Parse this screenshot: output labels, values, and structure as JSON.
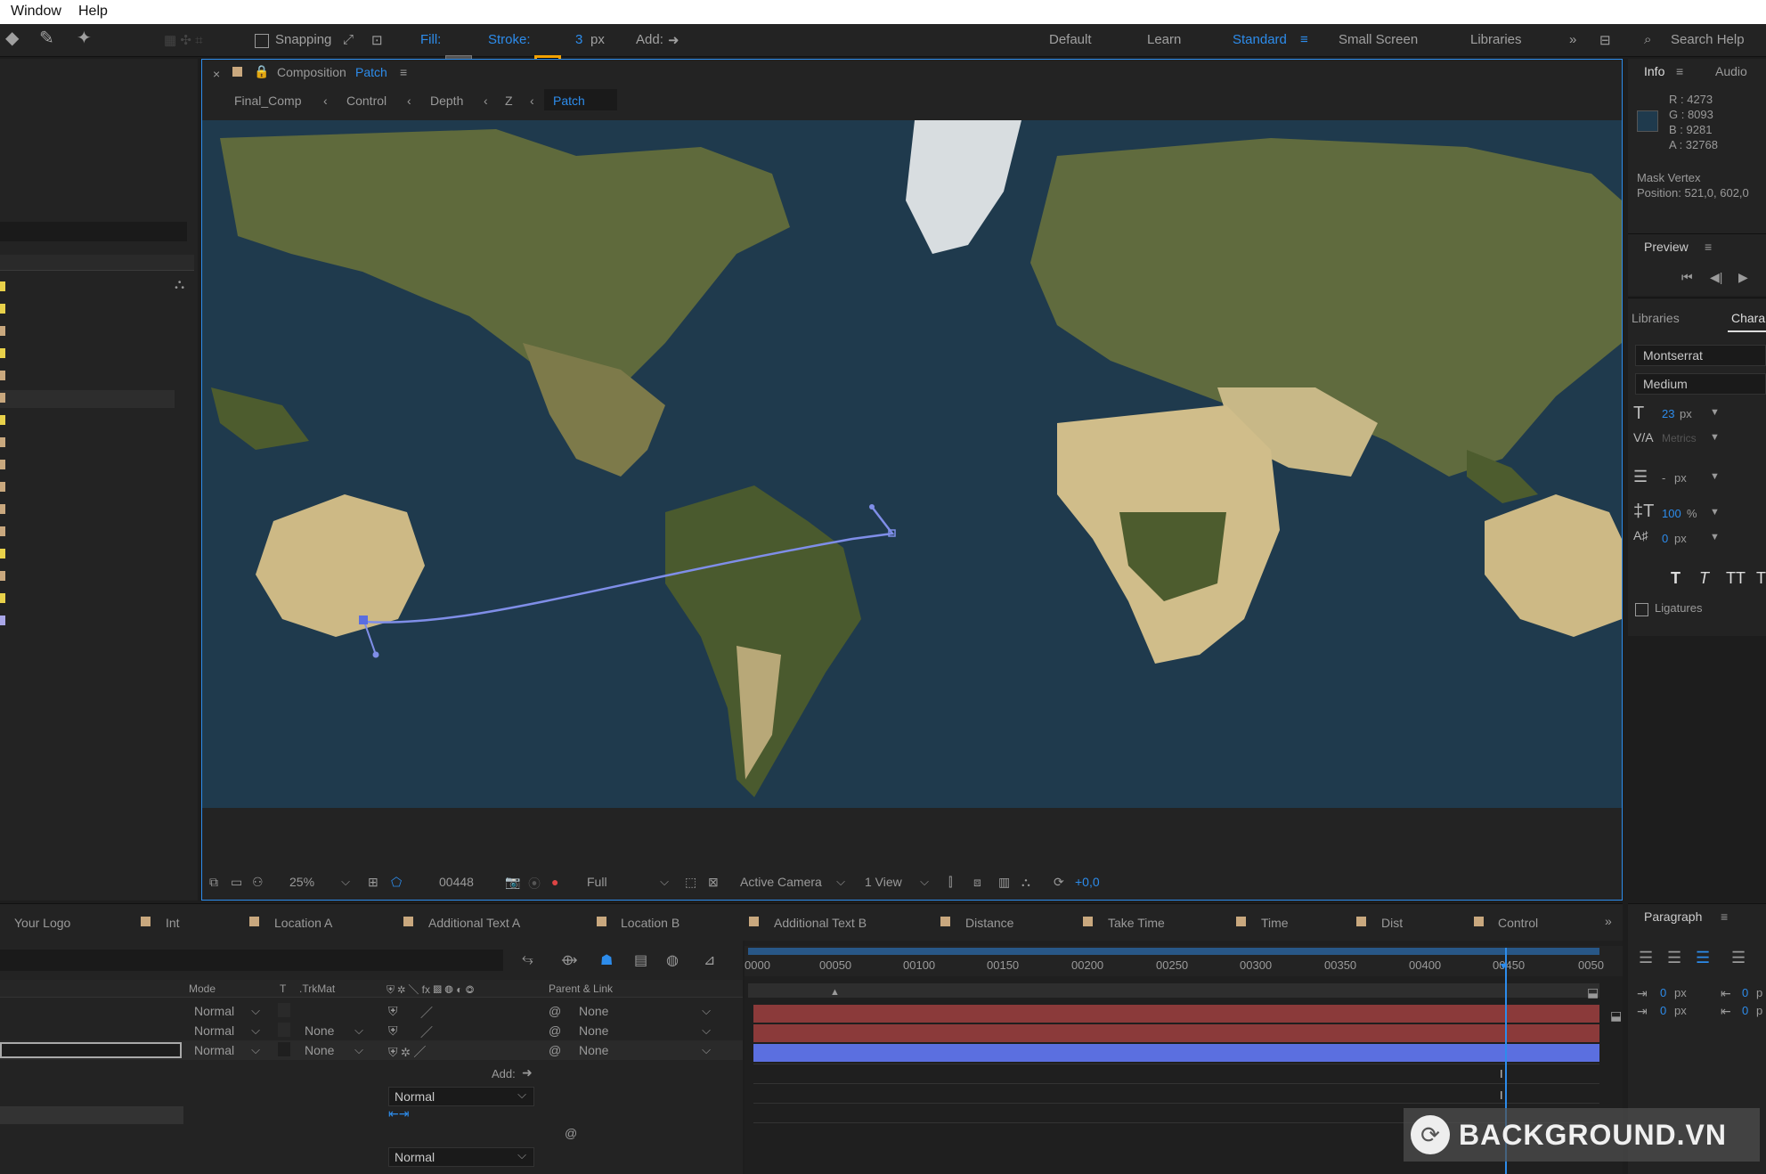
{
  "menu": {
    "items": [
      "Window",
      "Help"
    ]
  },
  "toolbar": {
    "snapping": "Snapping",
    "fill": "Fill:",
    "stroke": "Stroke:",
    "stroke_width": "3",
    "stroke_unit": "px",
    "add": "Add:",
    "workspaces": [
      "Default",
      "Learn",
      "Standard",
      "Small Screen",
      "Libraries"
    ],
    "active_workspace": "Standard",
    "search_help": "Search Help"
  },
  "composition": {
    "tab_prefix": "Composition",
    "tab_name": "Patch",
    "breadcrumbs": [
      "Final_Comp",
      "Control",
      "Depth",
      "Z",
      "Patch"
    ],
    "zoom": "25%",
    "timecode": "00448",
    "resolution": "Full",
    "camera": "Active Camera",
    "views": "1 View",
    "exposure": "+0,0"
  },
  "info_panel": {
    "tabs": [
      "Info",
      "Audio"
    ],
    "r": "R : 4273",
    "g": "G : 8093",
    "b": "B : 9281",
    "a": "A : 32768",
    "mask_title": "Mask Vertex",
    "mask_position": "Position: 521,0, 602,0"
  },
  "preview_panel": {
    "title": "Preview"
  },
  "character_panel": {
    "tabs": [
      "Libraries",
      "Chara"
    ],
    "font": "Montserrat",
    "style": "Medium",
    "size": "23",
    "size_unit": "px",
    "kerning": "Metrics",
    "leading": "-",
    "leading_unit": "px",
    "vscale": "100",
    "vscale_unit": "%",
    "baseline": "0",
    "baseline_unit": "px",
    "ligatures": "Ligatures",
    "styles": [
      "T",
      "T",
      "TT",
      "T"
    ]
  },
  "paragraph_panel": {
    "title": "Paragraph",
    "indent1": "0",
    "indent2": "0",
    "unit": "px",
    "right1": "0",
    "right2": "0",
    "unit_short": "p"
  },
  "timeline": {
    "tabs": [
      "Your Logo",
      "Int",
      "Location A",
      "Additional Text A",
      "Location B",
      "Additional Text B",
      "Distance",
      "Take Time",
      "Time",
      "Dist",
      "Control"
    ],
    "ruler": [
      "0000",
      "00050",
      "00100",
      "00150",
      "00200",
      "00250",
      "00300",
      "00350",
      "00400",
      "00450",
      "0050"
    ],
    "columns": {
      "mode": "Mode",
      "t": "T",
      "trkmat": ".TrkMat",
      "parent": "Parent & Link"
    },
    "layers": [
      {
        "mode": "Normal",
        "trkmat": "",
        "parent": "None",
        "color": "#8b3a3a"
      },
      {
        "mode": "Normal",
        "trkmat": "None",
        "parent": "None",
        "color": "#8b3a3a"
      },
      {
        "mode": "Normal",
        "trkmat": "None",
        "parent": "None",
        "color": "#5b6fe0"
      }
    ],
    "add": "Add:",
    "blend1": "Normal",
    "blend2": "Normal"
  },
  "watermark": "BACKGROUND.VN"
}
